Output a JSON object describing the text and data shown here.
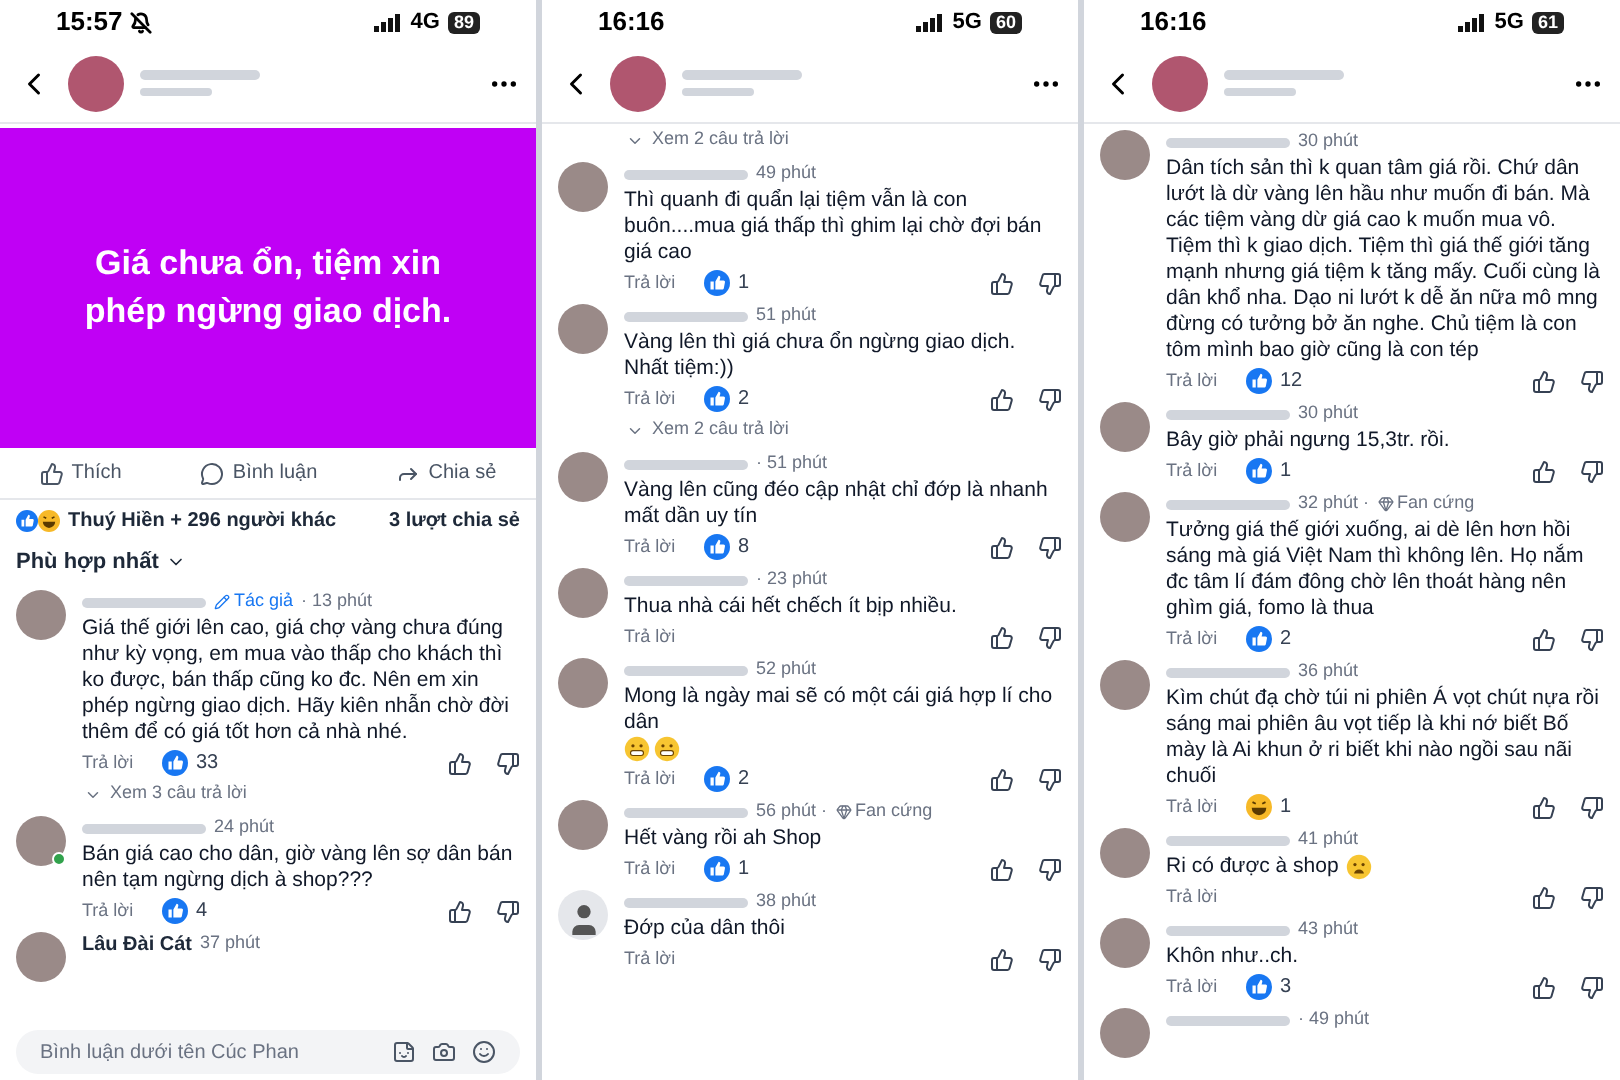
{
  "phones": [
    {
      "status": {
        "time": "15:57",
        "silent": true,
        "network": "4G",
        "battery": "89"
      },
      "post": {
        "text": "Giá chưa ổn, tiệm xin phép ngừng giao dịch.",
        "actions": [
          {
            "kind": "like",
            "label": "Thích"
          },
          {
            "kind": "comment",
            "label": "Bình luận"
          },
          {
            "kind": "share",
            "label": "Chia sẻ"
          }
        ],
        "reactions": "Thuý Hiền + 296 người khác",
        "shares": "3 lượt chia sẻ",
        "sort": "Phù hợp nhất"
      },
      "feed": [
        {
          "kind": "comment",
          "default_avatar": false,
          "online": false,
          "author_badge": "Tác giả",
          "time": "· 13 phút",
          "text": "Giá thế giới lên cao, giá chợ vàng chưa đúng như kỳ vọng, em mua vào thấp cho khách thì ko được, bán thấp cũng ko đc. Nên em xin phép ngừng giao dịch. Hãy kiên nhẫn chờ đời thêm để có giá tốt hơn cả nhà nhé.",
          "reply": "Trả lời",
          "laughing": false,
          "likes": "33"
        },
        {
          "kind": "replies_link",
          "label": "Xem 3 câu trả lời"
        },
        {
          "kind": "comment",
          "default_avatar": false,
          "online": true,
          "time": "24 phút",
          "text": "Bán giá cao cho dân, giờ vàng lên sợ dân bán nên tạm ngừng dịch à shop???",
          "reply": "Trả lời",
          "laughing": false,
          "likes": "4"
        },
        {
          "kind": "comment",
          "default_avatar": false,
          "online": false,
          "name": "Lâu Đài Cát",
          "time": "37 phút"
        }
      ],
      "comment_input": {
        "placeholder": "Bình luận dưới tên Cúc Phan"
      }
    },
    {
      "status": {
        "time": "16:16",
        "silent": false,
        "network": "5G",
        "battery": "60"
      },
      "feed": [
        {
          "kind": "replies_link",
          "label": "Xem 2 câu trả lời"
        },
        {
          "kind": "comment",
          "default_avatar": false,
          "online": false,
          "time": "49 phút",
          "text": "Thì quanh đi quẩn lại tiệm vẫn là con buôn....mua giá thấp thì ghim lại chờ đợi bán giá cao",
          "reply": "Trả lời",
          "laughing": false,
          "likes": "1"
        },
        {
          "kind": "comment",
          "default_avatar": false,
          "online": false,
          "time": "51 phút",
          "text": "Vàng lên thì giá chưa ổn ngừng giao dịch. Nhất tiệm:))",
          "reply": "Trả lời",
          "laughing": false,
          "likes": "2"
        },
        {
          "kind": "replies_link",
          "label": "Xem 2 câu trả lời"
        },
        {
          "kind": "comment",
          "default_avatar": false,
          "online": false,
          "time": "· 51 phút",
          "text": "Vàng lên cũng đéo cập nhật chỉ đớp là nhanh mất dần uy tín",
          "reply": "Trả lời",
          "laughing": false,
          "likes": "8"
        },
        {
          "kind": "comment",
          "default_avatar": false,
          "online": false,
          "time": "· 23 phút",
          "text": "Thua nhà cái hết chếch ít bịp nhiều.",
          "reply": "Trả lời"
        },
        {
          "kind": "comment",
          "default_avatar": false,
          "online": false,
          "time": "52 phút",
          "text": "Mong là ngày mai sẽ có một cái giá hợp lí cho dân",
          "emojis": [
            {
              "kind": "grin"
            },
            {
              "kind": "grin"
            }
          ],
          "emoji_inline": false,
          "reply": "Trả lời",
          "laughing": false,
          "likes": "2"
        },
        {
          "kind": "comment",
          "default_avatar": false,
          "online": false,
          "time": "56 phút ·",
          "fan_badge": "Fan cứng",
          "text": "Hết vàng rồi ah Shop",
          "reply": "Trả lời",
          "laughing": false,
          "likes": "1"
        },
        {
          "kind": "comment",
          "default_avatar": true,
          "online": false,
          "time": "38 phút",
          "text": "Đớp của dân thôi",
          "reply": "Trả lời"
        }
      ]
    },
    {
      "status": {
        "time": "16:16",
        "silent": false,
        "network": "5G",
        "battery": "61"
      },
      "feed": [
        {
          "kind": "comment",
          "default_avatar": false,
          "online": false,
          "time": "30 phút",
          "text": "Dân tích sản thì k quan tâm giá rồi. Chứ dân lướt là dừ vàng lên hầu như muốn đi bán. Mà các tiệm vàng dừ giá cao k muốn mua vô. Tiệm thì k giao dịch. Tiệm thì giá thế giới tăng mạnh nhưng giá tiệm k tăng mấy. Cuối cùng là dân khổ nha. Dạo ni lướt k dễ ăn nữa mô mng đừng có tưởng bở ăn nghe. Chủ tiệm là con tôm mình bao giờ cũng là con tép",
          "reply": "Trả lời",
          "laughing": false,
          "likes": "12"
        },
        {
          "kind": "comment",
          "default_avatar": false,
          "online": false,
          "time": "30 phút",
          "text": "Bây giờ phải ngưng 15,3tr.  rồi.",
          "reply": "Trả lời",
          "laughing": false,
          "likes": "1"
        },
        {
          "kind": "comment",
          "default_avatar": false,
          "online": false,
          "time": "32 phút ·",
          "fan_badge": "Fan cứng",
          "text": "Tưởng giá thế giới xuống, ai dè lên hơn hồi sáng mà giá Việt Nam thì không lên. Họ nắm đc tâm lí đám đông chờ lên thoát hàng nên ghìm giá, fomo là thua",
          "reply": "Trả lời",
          "laughing": false,
          "likes": "2"
        },
        {
          "kind": "comment",
          "default_avatar": false,
          "online": false,
          "time": "36 phút",
          "text": "Kìm chút đạ chờ túi ni phiên Á vọt chút nựa rồi sáng mai phiên âu vọt tiếp là khi nớ biết Bố mày là Ai khun ở ri biết khi nào ngồi sau nãi chuối",
          "reply": "Trả lời",
          "laughing": true,
          "likes": "1"
        },
        {
          "kind": "comment",
          "default_avatar": false,
          "online": false,
          "time": "41 phút",
          "text": "Ri có được à shop",
          "emojis": [
            {
              "kind": "sad"
            }
          ],
          "emoji_inline": true,
          "reply": "Trả lời"
        },
        {
          "kind": "comment",
          "default_avatar": false,
          "online": false,
          "time": "43 phút",
          "text": "Khôn như..ch.",
          "reply": "Trả lời",
          "laughing": false,
          "likes": "3"
        },
        {
          "kind": "comment",
          "default_avatar": false,
          "online": false,
          "time": "· 49 phút"
        }
      ]
    }
  ]
}
